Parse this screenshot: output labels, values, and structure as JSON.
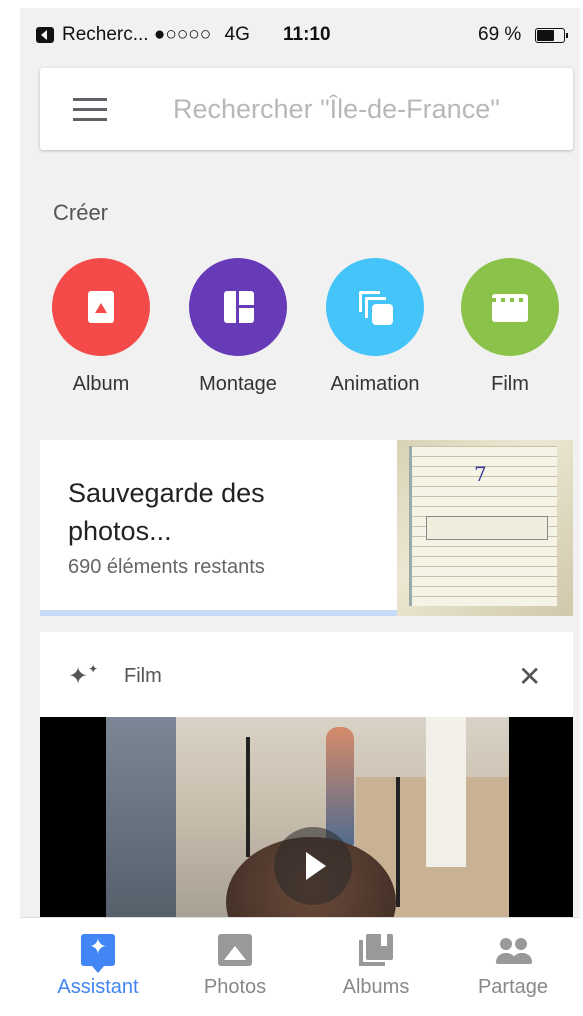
{
  "status_bar": {
    "back_app": "Recherc...",
    "signal": "●○○○○",
    "network": "4G",
    "time": "11:10",
    "battery_text": "69 %",
    "battery_level": 0.69
  },
  "search": {
    "placeholder": "Rechercher \"Île-de-France\""
  },
  "create_section": {
    "title": "Créer",
    "items": [
      {
        "label": "Album",
        "icon": "album-icon",
        "color": "#f44a4a"
      },
      {
        "label": "Montage",
        "icon": "collage-icon",
        "color": "#673ab7"
      },
      {
        "label": "Animation",
        "icon": "animation-icon",
        "color": "#45c4f9"
      },
      {
        "label": "Film",
        "icon": "film-icon",
        "color": "#8bc34a"
      }
    ]
  },
  "backup_card": {
    "title": "Sauvegarde des photos...",
    "subtitle": "690 éléments restants",
    "thumb_number": "7",
    "progress_color": "#c6d9f7"
  },
  "film_card": {
    "label": "Film",
    "icon": "sparkle-icon",
    "close": "✕"
  },
  "bottom_nav": {
    "items": [
      {
        "label": "Assistant",
        "icon": "assistant-icon",
        "active": true
      },
      {
        "label": "Photos",
        "icon": "photos-icon",
        "active": false
      },
      {
        "label": "Albums",
        "icon": "albums-icon",
        "active": false
      },
      {
        "label": "Partage",
        "icon": "sharing-icon",
        "active": false
      }
    ],
    "active_color": "#4285f4"
  }
}
